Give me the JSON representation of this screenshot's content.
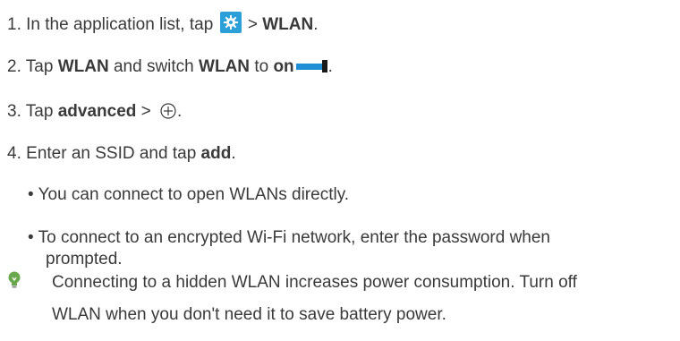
{
  "steps": [
    {
      "num": "1.",
      "pre": "In the application list, tap",
      "mid": ">",
      "bold": "WLAN",
      "post": "."
    },
    {
      "num": "2.",
      "pre": "Tap",
      "bold1": "WLAN",
      "mid": "and switch",
      "bold2": "WLAN",
      "to": "to",
      "bold3": "on",
      "post": "."
    },
    {
      "num": "3.",
      "pre": "Tap",
      "bold": "advanced",
      "mid": ">",
      "post": "."
    },
    {
      "num": "4.",
      "pre": "Enter an SSID and tap",
      "bold": "add",
      "post": "."
    }
  ],
  "bullets": [
    {
      "marker": "•",
      "text": "You can connect to open WLANs directly."
    },
    {
      "marker": "•",
      "text": "To connect to an encrypted Wi-Fi network, enter the password when",
      "continuation": "prompted."
    }
  ],
  "note": {
    "line1": "Connecting to a hidden WLAN increases power consumption. Turn off",
    "line2": "WLAN when you don't need it to save battery power."
  },
  "icons": {
    "settings": "settings-gear-icon",
    "toggle": "toggle-switch-icon",
    "plus": "add-circle-icon",
    "tip": "lightbulb-icon",
    "accent": "#2a9fd8",
    "tip_color": "#6aa84f"
  }
}
